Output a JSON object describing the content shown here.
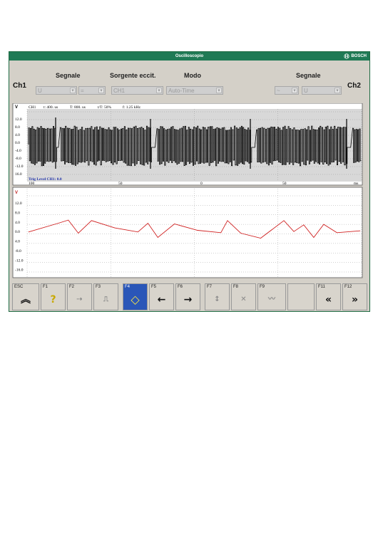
{
  "window": {
    "title": "Oscilloscopio",
    "logo_text": "BOSCH"
  },
  "controls": {
    "ch1_label": "Ch1",
    "ch2_label": "Ch2",
    "segnale_label_left": "Segnale",
    "sorgente_label": "Sorgente eccit.",
    "modo_label": "Modo",
    "segnale_label_right": "Segnale",
    "left_signal_value": "U",
    "left_operator_value": "=",
    "sorgente_value": "CH1",
    "modo_value": "Auto-Time",
    "right_coupling_value": "~",
    "right_signal_value": "U"
  },
  "channel1": {
    "unit_label": "V",
    "header": {
      "ch": "CH1",
      "t_div": "t: 400. us",
      "period": "T: 800. us",
      "duty": "t/T: 50%",
      "freq": "f: 1.25 kHz"
    },
    "y_ticks": [
      "12.0",
      "8.0",
      "4.0",
      "0.0",
      "-4.0",
      "-8.0",
      "-12.0",
      "16.0"
    ],
    "trig_level": "Trig Level CH1: 0.0",
    "x_ticks": [
      "100",
      "50",
      "0",
      "50",
      "ms"
    ]
  },
  "channel2": {
    "unit_label": "V",
    "y_ticks": [
      "12.0",
      "8.0",
      "4.0",
      "0.0",
      "4.0",
      "-8.0",
      "-12.0",
      "-16.0"
    ]
  },
  "function_keys": [
    {
      "label": "ESC",
      "icon": "double-chevron-up-icon"
    },
    {
      "label": "F1",
      "icon": "help-icon"
    },
    {
      "label": "F2",
      "icon": "cursor-disabled-icon"
    },
    {
      "label": "F3",
      "icon": "trigger-disabled-icon"
    },
    {
      "label": "F4",
      "icon": "diamond-icon"
    },
    {
      "label": "F5",
      "icon": "arrow-left-icon"
    },
    {
      "label": "F6",
      "icon": "arrow-right-icon"
    },
    {
      "label": "F7",
      "icon": "zoom-y-x-icon"
    },
    {
      "label": "F8",
      "icon": "scale-x-icon"
    },
    {
      "label": "F9",
      "icon": "waveform-icon"
    },
    {
      "label": "",
      "icon": ""
    },
    {
      "label": "F11",
      "icon": "double-chevron-left-icon"
    },
    {
      "label": "F12",
      "icon": "double-chevron-right-icon"
    }
  ],
  "chart_data": [
    {
      "type": "line",
      "title": "",
      "xlabel": "ms",
      "ylabel": "V",
      "ylim": [
        -16,
        16
      ],
      "x_tick_labels": [
        "100",
        "50",
        "0",
        "50"
      ],
      "series": [
        {
          "values_description": "",
          "x": [],
          "y": []
        }
      ]
    },
    {
      "type": "line",
      "title": "",
      "xlabel": "",
      "ylabel": "V",
      "ylim": [
        -16,
        16
      ],
      "series": [
        {
          "x": [
            0,
            9,
            12,
            15,
            19,
            26,
            33,
            36,
            39,
            44,
            51,
            58,
            60,
            64,
            70,
            77,
            80,
            83,
            86,
            89,
            93,
            100
          ],
          "y": [
            0.8,
            4.5,
            5.8,
            0.3,
            5.6,
            2.5,
            0.8,
            4.5,
            -1.5,
            4.2,
            1.5,
            0.5,
            5.6,
            0.3,
            -1.8,
            5.6,
            1.0,
            3.8,
            -1.5,
            4.0,
            0.5,
            1.3
          ]
        }
      ]
    }
  ]
}
